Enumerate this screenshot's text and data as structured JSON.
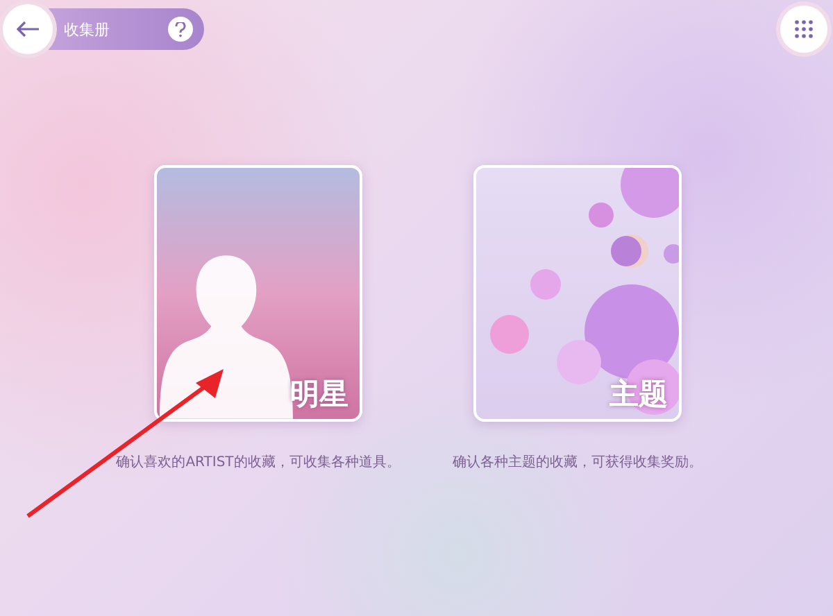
{
  "header": {
    "title": "收集册"
  },
  "cards": [
    {
      "kind": "artist",
      "label": "明星",
      "caption": "确认喜欢的ARTIST的收藏，可收集各种道具。"
    },
    {
      "kind": "theme",
      "label": "主题",
      "caption": "确认各种主题的收藏，可获得收集奖励。"
    }
  ]
}
